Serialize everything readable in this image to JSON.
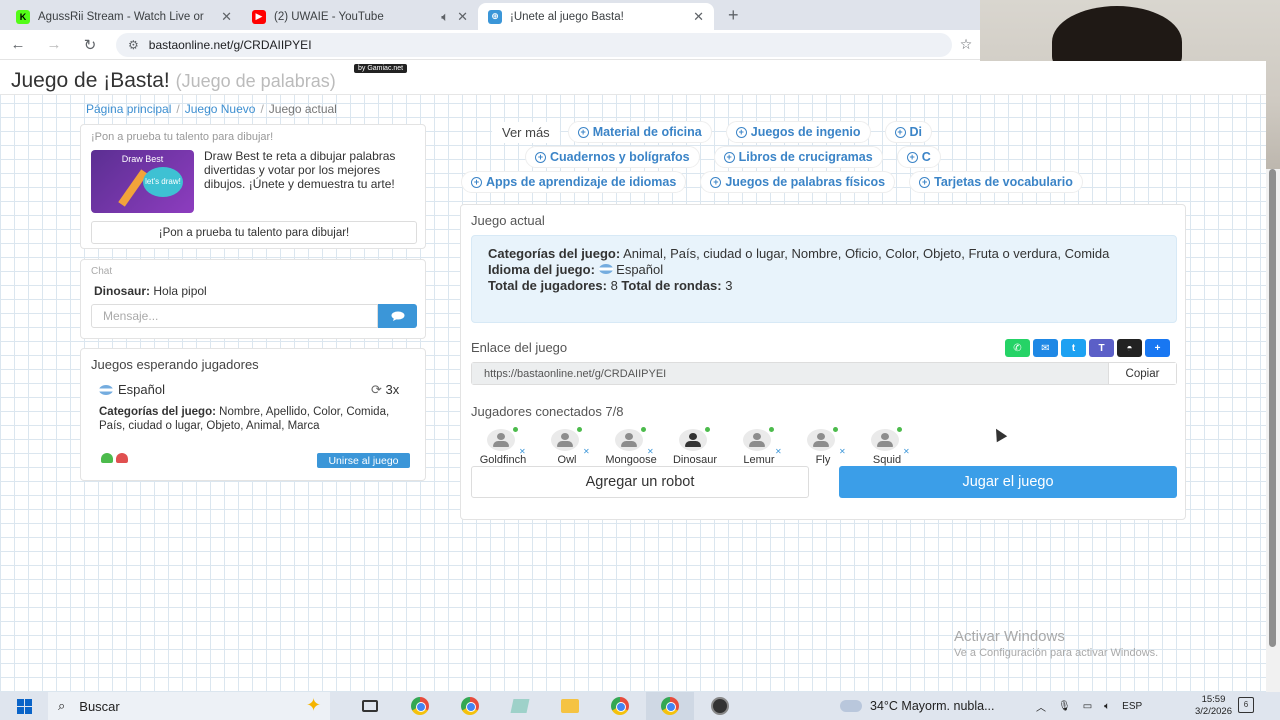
{
  "browser": {
    "tabs": [
      {
        "title": "AgussRii Stream - Watch Live or",
        "favicon_color": "#53fc18",
        "favicon_letter": "K",
        "favicon_text_color": "#000000"
      },
      {
        "title": "(2) UWAIE - YouTube",
        "favicon_color": "#ff0000",
        "favicon_letter": "▶",
        "favicon_text_color": "#ffffff",
        "audio_icon": "speaker-icon"
      },
      {
        "title": "¡Únete al juego Basta!",
        "favicon_color": "#3b96d8",
        "favicon_letter": "⊕",
        "favicon_text_color": "#ffffff",
        "active": true
      }
    ],
    "url": "bastaonline.net/g/CRDAIIPYEI"
  },
  "site": {
    "title": "Juego de ¡Basta!",
    "subtitle": "(Juego de palabras)",
    "badge": "by Gamiac.net"
  },
  "breadcrumb": {
    "home": "Página principal",
    "new_game": "Juego Nuevo",
    "current": "Juego actual"
  },
  "promo": {
    "heading": "¡Pon a prueba tu talento para dibujar!",
    "image_title": "Draw Best",
    "image_bubble": "let's draw!",
    "text": "Draw Best te reta a dibujar palabras divertidas y votar por los mejores dibujos. ¡Únete y demuestra tu arte!",
    "button": "¡Pon a prueba tu talento para dibujar!"
  },
  "chat": {
    "heading": "Chat",
    "message_author": "Dinosaur:",
    "message_text": "Hola pipol",
    "input_placeholder": "Mensaje..."
  },
  "waiting": {
    "heading": "Juegos esperando jugadores",
    "language": "Español",
    "rounds": "3x",
    "categories_label": "Categorías del juego:",
    "categories": "Nombre, Apellido, Color, Comida, País, ciudad o lugar, Objeto, Animal, Marca",
    "join_button": "Unirse al juego"
  },
  "tags": {
    "more": "Ver más",
    "row1": [
      "Material de oficina",
      "Juegos de ingenio",
      "Di"
    ],
    "row2": [
      "Cuadernos y bolígrafos",
      "Libros de crucigramas",
      "C"
    ],
    "row3": [
      "Apps de aprendizaje de idiomas",
      "Juegos de palabras físicos",
      "Tarjetas de vocabulario"
    ]
  },
  "game": {
    "heading": "Juego actual",
    "categories_label": "Categorías del juego:",
    "categories": "Animal, País, ciudad o lugar, Nombre, Oficio, Color, Objeto, Fruta o verdura, Comida",
    "language_label": "Idioma del juego:",
    "language": "Español",
    "players_label": "Total de jugadores:",
    "players": "8",
    "rounds_label": "Total de rondas:",
    "rounds": "3",
    "link_heading": "Enlace del juego",
    "link": "https://bastaonline.net/g/CRDAIIPYEI",
    "copy_button": "Copiar",
    "share": [
      {
        "name": "whatsapp",
        "color": "#25d366",
        "glyph": "✆"
      },
      {
        "name": "messenger",
        "color": "#1e88e5",
        "glyph": "✉"
      },
      {
        "name": "twitter",
        "color": "#1da1f2",
        "glyph": "t"
      },
      {
        "name": "teams",
        "color": "#5b5fc7",
        "glyph": "T"
      },
      {
        "name": "snapchat",
        "color": "#222222",
        "glyph": "◓"
      },
      {
        "name": "more",
        "color": "#1877f2",
        "glyph": "+"
      }
    ],
    "connected_heading": "Jugadores conectados 7/8",
    "players_list": [
      "Goldfinch",
      "Owl",
      "Mongoose",
      "Dinosaur",
      "Lemur",
      "Fly",
      "Squid"
    ],
    "add_robot_button": "Agregar un robot",
    "play_button": "Jugar el juego"
  },
  "watermark": {
    "line1": "Activar Windows",
    "line2": "Ve a Configuración para activar Windows."
  },
  "taskbar": {
    "search_placeholder": "Buscar",
    "weather": "34°C  Mayorm. nubla...",
    "weather_badge": "3",
    "language": "ESP",
    "time": "15:59",
    "date": "3/2/2026",
    "notifications": "6"
  }
}
